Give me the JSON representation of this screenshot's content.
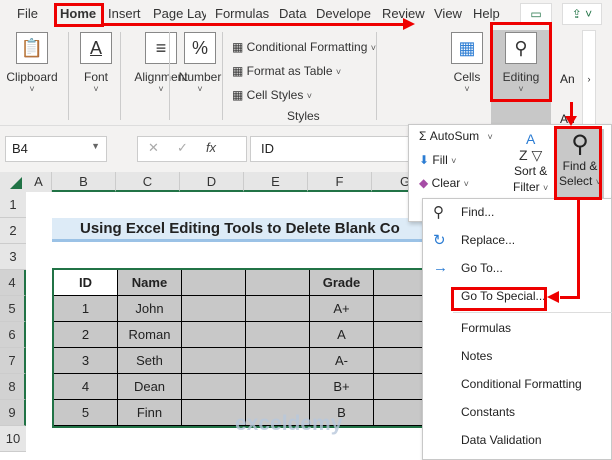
{
  "tabs": [
    "File",
    "Home",
    "Insert",
    "Page Layo",
    "Formulas",
    "Data",
    "Develope",
    "Review",
    "View",
    "Help"
  ],
  "ribbon": {
    "clipboard": "Clipboard",
    "font": "Font",
    "alignment": "Alignment",
    "number": "Number",
    "cond_fmt": "Conditional Formatting",
    "fmt_table": "Format as Table",
    "cell_styles": "Cell Styles",
    "styles": "Styles",
    "cells": "Cells",
    "editing": "Editing",
    "analyze": "An",
    "analyze2": "An"
  },
  "formula_bar": {
    "name_box": "B4",
    "fx": "fx",
    "value": "ID"
  },
  "columns": [
    "A",
    "B",
    "C",
    "D",
    "E",
    "F",
    "G"
  ],
  "rows": [
    "1",
    "2",
    "3",
    "4",
    "5",
    "6",
    "7",
    "8",
    "9",
    "10"
  ],
  "title": "Using Excel Editing Tools to Delete Blank Co",
  "table": {
    "headers": [
      "ID",
      "Name",
      "",
      "",
      "Grade",
      ""
    ],
    "rows": [
      [
        "1",
        "John",
        "",
        "",
        "A+",
        ""
      ],
      [
        "2",
        "Roman",
        "",
        "",
        "A",
        ""
      ],
      [
        "3",
        "Seth",
        "",
        "",
        "A-",
        ""
      ],
      [
        "4",
        "Dean",
        "",
        "",
        "B+",
        ""
      ],
      [
        "5",
        "Finn",
        "",
        "",
        "B",
        ""
      ]
    ]
  },
  "editing_panel": {
    "autosum": "AutoSum",
    "fill": "Fill",
    "clear": "Clear",
    "sort1": "Sort &",
    "sort2": "Filter",
    "find1": "Find &",
    "find2": "Select"
  },
  "menu": {
    "items": [
      "Find...",
      "Replace...",
      "Go To...",
      "Go To Special...",
      "Formulas",
      "Notes",
      "Conditional Formatting",
      "Constants",
      "Data Validation"
    ]
  },
  "watermark": "exceldemy",
  "colors": {
    "highlight": "#e00000",
    "excel_green": "#217346",
    "title_bg": "#ddebf7"
  }
}
